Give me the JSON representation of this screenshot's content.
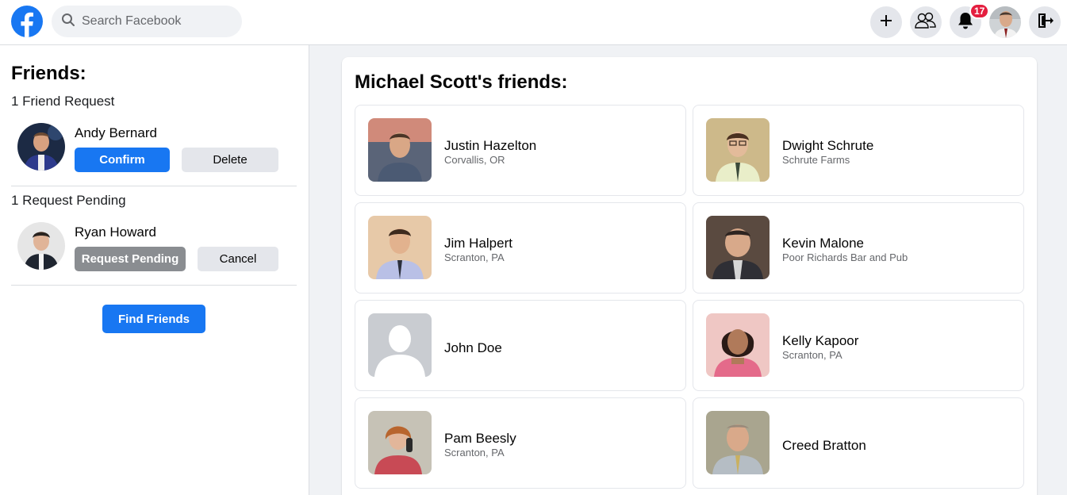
{
  "topbar": {
    "search_placeholder": "Search Facebook",
    "notification_count": "17"
  },
  "left": {
    "title": "Friends:",
    "requests_heading": "1 Friend Request",
    "request": {
      "name": "Andy Bernard",
      "confirm_label": "Confirm",
      "delete_label": "Delete"
    },
    "pending_heading": "1 Request Pending",
    "pending": {
      "name": "Ryan Howard",
      "status_label": "Request Pending",
      "cancel_label": "Cancel"
    },
    "find_friends_label": "Find Friends"
  },
  "main": {
    "title": "Michael Scott's friends:",
    "friends": [
      {
        "name": "Justin Hazelton",
        "location": "Corvallis, OR"
      },
      {
        "name": "Dwight Schrute",
        "location": "Schrute Farms"
      },
      {
        "name": "Jim Halpert",
        "location": "Scranton, PA"
      },
      {
        "name": "Kevin Malone",
        "location": "Poor Richards Bar and Pub"
      },
      {
        "name": "John Doe",
        "location": ""
      },
      {
        "name": "Kelly Kapoor",
        "location": "Scranton, PA"
      },
      {
        "name": "Pam Beesly",
        "location": "Scranton, PA"
      },
      {
        "name": "Creed Bratton",
        "location": ""
      }
    ]
  },
  "colors": {
    "brand_blue": "#1877f2",
    "badge_red": "#e41e3f",
    "page_bg": "#f0f2f5"
  },
  "icons": [
    "facebook-logo-icon",
    "search-icon",
    "plus-icon",
    "friends-icon",
    "bell-icon",
    "logout-icon"
  ]
}
